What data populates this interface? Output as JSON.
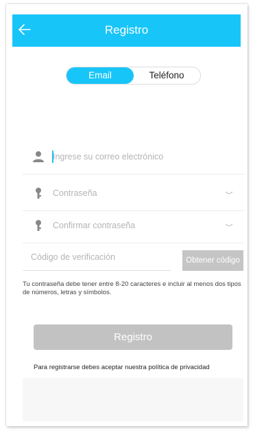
{
  "header": {
    "title": "Registro",
    "back_icon": "arrow-left-icon"
  },
  "tabs": {
    "email": "Email",
    "phone": "Teléfono",
    "active": "email"
  },
  "form": {
    "email_placeholder": "Ingrese su correo electrónico",
    "password_placeholder": "Contraseña",
    "confirm_placeholder": "Confirmar contraseña",
    "code_placeholder": "Código de verificación",
    "get_code_label": "Obtener código"
  },
  "hint": "Tu contraseña debe tener entre 8-20 caracteres e incluir al menos dos tipos de números, letras y símbolos.",
  "submit_label": "Registro",
  "policy_text": "Para registrarse debes aceptar nuestra política de privacidad",
  "colors": {
    "accent": "#17c5f9",
    "disabled": "#c2c2c2",
    "placeholder": "#b4b4b4"
  }
}
